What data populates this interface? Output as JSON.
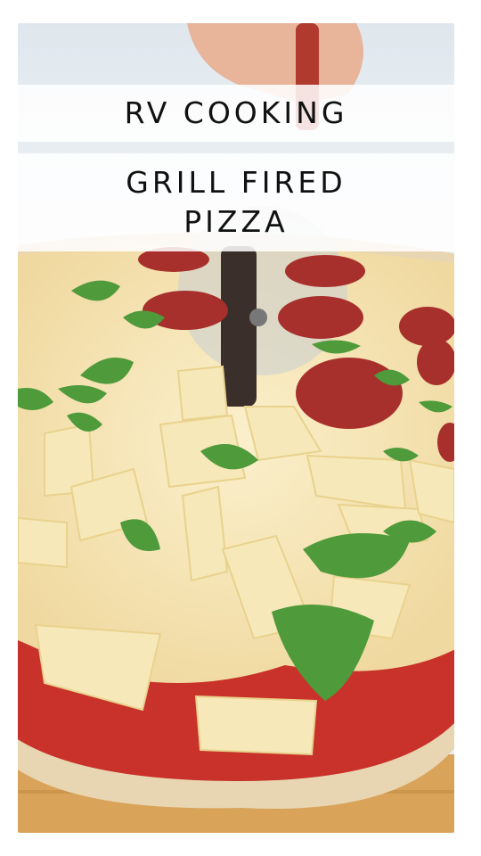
{
  "overlay": {
    "heading": "RV COOKING",
    "title_line_1": "GRILL FIRED",
    "title_line_2": "PIZZA"
  },
  "photo": {
    "subject": "pizza-with-pineapple-pepperoni-basil",
    "colors": {
      "sky": "#e6edf2",
      "board": "#d9a35a",
      "crust": "#e8d6b2",
      "sauce": "#c9322a",
      "cheese": "#f3e3b5",
      "pineapple": "#f6e8b8",
      "pepperoni": "#a8302c",
      "basil": "#4f9a3a"
    }
  }
}
